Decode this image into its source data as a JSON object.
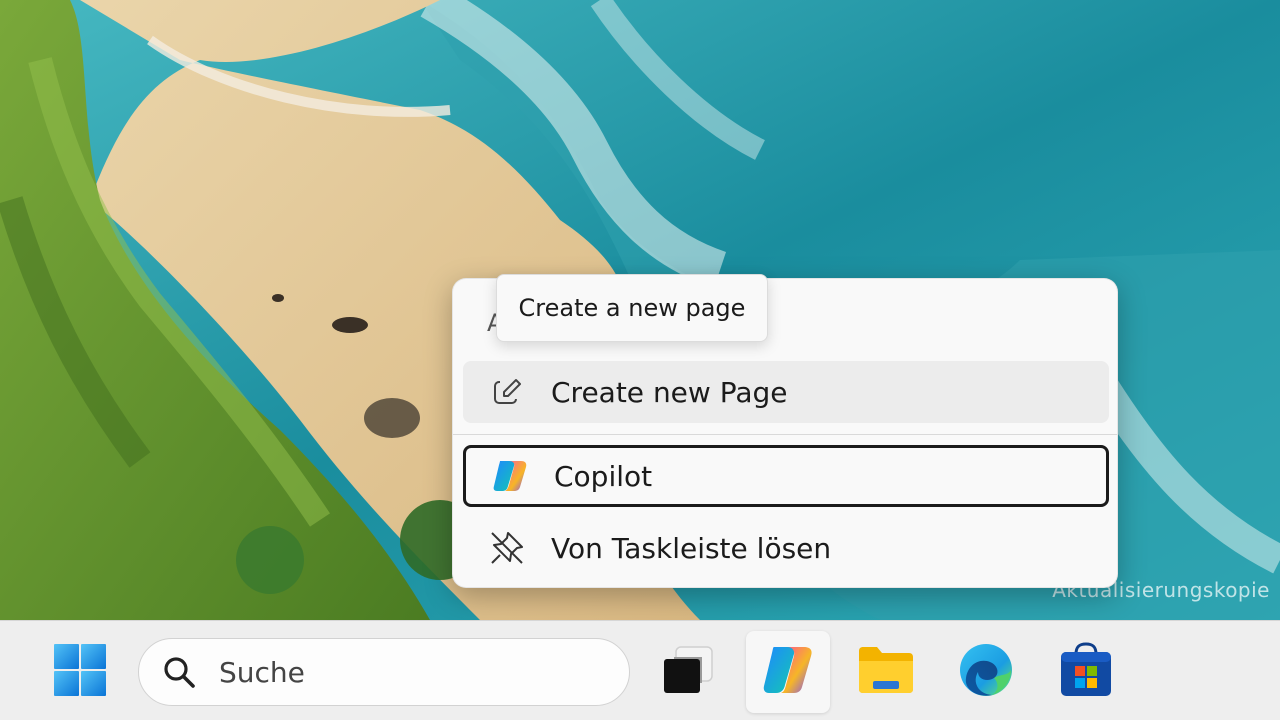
{
  "context_menu": {
    "partial_header": "A",
    "items": [
      {
        "label": "Create new Page",
        "icon": "edit-icon"
      },
      {
        "label": "Copilot",
        "icon": "copilot-icon"
      },
      {
        "label": "Von Taskleiste lösen",
        "icon": "unpin-icon"
      }
    ]
  },
  "tooltip": {
    "text": "Create a new page"
  },
  "taskbar": {
    "search_placeholder": "Suche",
    "apps": [
      {
        "name": "Start",
        "icon": "windows-logo-icon"
      },
      {
        "name": "Task View",
        "icon": "task-view-icon"
      },
      {
        "name": "Copilot",
        "icon": "copilot-icon",
        "active": true
      },
      {
        "name": "File Explorer",
        "icon": "folder-icon"
      },
      {
        "name": "Microsoft Edge",
        "icon": "edge-icon"
      },
      {
        "name": "Microsoft Store",
        "icon": "store-icon"
      }
    ]
  },
  "wallpaper": {
    "watermark_text": "Aktualisierungskopie"
  },
  "colors": {
    "accent": "#0067c0",
    "menu_bg": "#f9f9f9",
    "taskbar_bg": "#eeeeee"
  }
}
